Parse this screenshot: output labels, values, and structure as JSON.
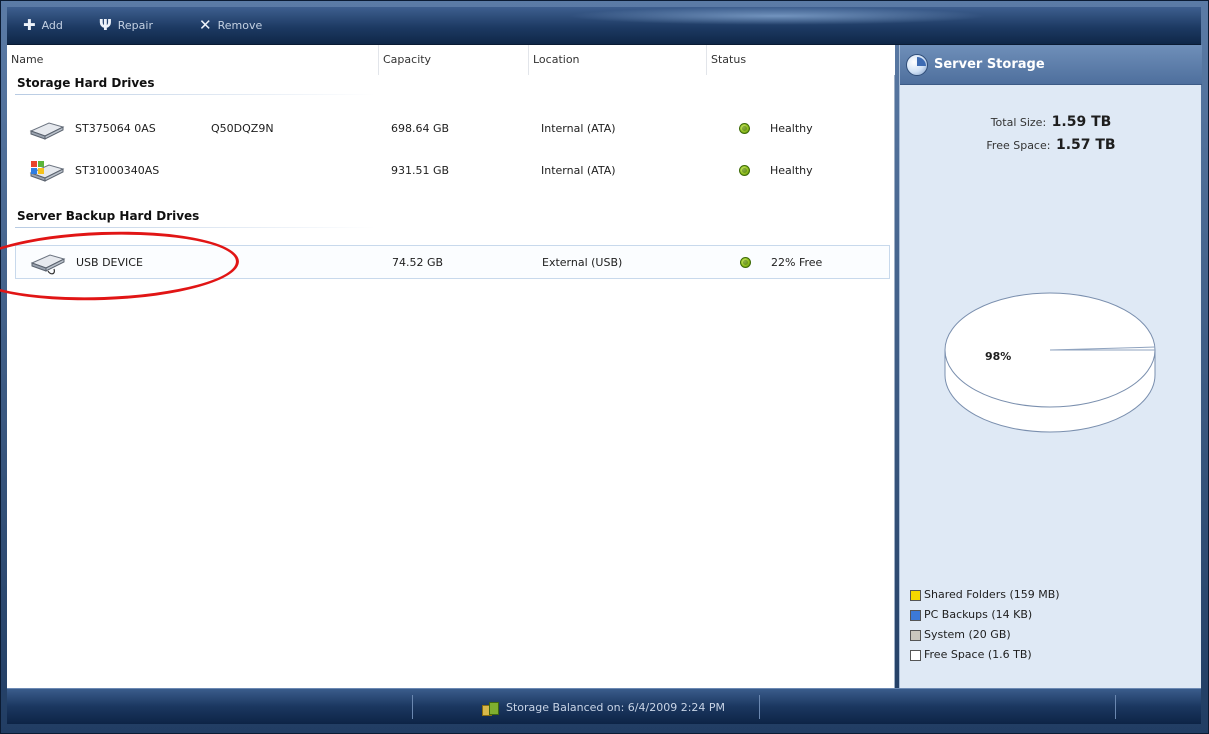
{
  "toolbar": {
    "add_label": "Add",
    "repair_label": "Repair",
    "remove_label": "Remove"
  },
  "columns": {
    "name": "Name",
    "capacity": "Capacity",
    "location": "Location",
    "status": "Status"
  },
  "groups": {
    "storage": {
      "label": "Storage Hard Drives",
      "rows": [
        {
          "name": "ST375064 0AS",
          "serial": "Q50DQZ9N",
          "capacity": "698.64 GB",
          "location": "Internal (ATA)",
          "status": "Healthy",
          "icon": "hard-drive-icon"
        },
        {
          "name": "ST31000340AS",
          "serial": "",
          "capacity": "931.51 GB",
          "location": "Internal (ATA)",
          "status": "Healthy",
          "icon": "system-drive-icon"
        }
      ]
    },
    "backup": {
      "label": "Server Backup Hard Drives",
      "rows": [
        {
          "name": "USB DEVICE",
          "capacity": "74.52 GB",
          "location": "External (USB)",
          "status": "22% Free",
          "icon": "usb-drive-icon"
        }
      ]
    }
  },
  "side": {
    "title": "Server Storage",
    "total_size_label": "Total Size:",
    "total_size_value": "1.59 TB",
    "free_space_label": "Free Space:",
    "free_space_value": "1.57 TB",
    "pie_label": "98%",
    "legend": [
      {
        "label": "Shared Folders (159 MB)",
        "color": "#f5d800"
      },
      {
        "label": "PC Backups (14 KB)",
        "color": "#3c79d8"
      },
      {
        "label": "System (20 GB)",
        "color": "#c9c6bd"
      },
      {
        "label": "Free Space (1.6 TB)",
        "color": "#ffffff"
      }
    ]
  },
  "chart_data": {
    "type": "pie",
    "labels": [
      "Shared Folders",
      "PC Backups",
      "System",
      "Free Space"
    ],
    "values": [
      159,
      1.4e-05,
      20480,
      1677721
    ],
    "unit": "MB",
    "annotations": [
      "98%"
    ]
  },
  "statusbar": {
    "message": "Storage Balanced on: 6/4/2009 2:24 PM"
  },
  "colors": {
    "status_ok": "#8ebc1d",
    "accent": "#4e6f9d",
    "highlight": "#e11515"
  }
}
